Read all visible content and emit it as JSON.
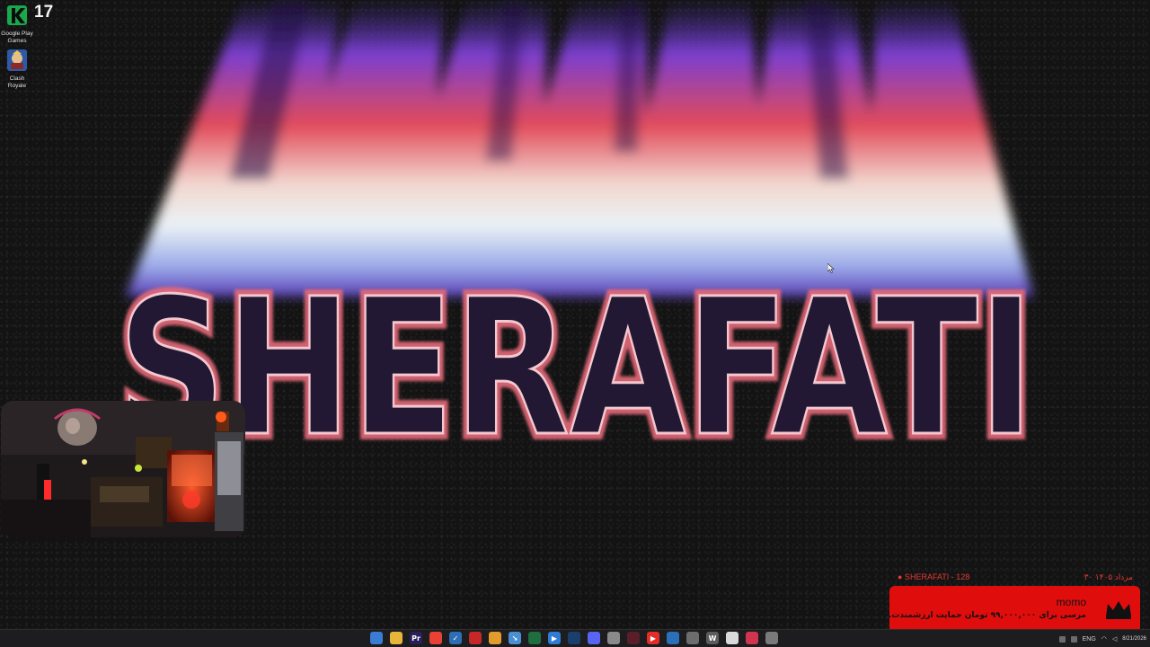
{
  "desktop": {
    "wallpaper_text": "SHERAFATI",
    "fps_counter": "17",
    "icons": [
      {
        "name": "google-play-games",
        "label": "Google Play Games",
        "icon": "google-play-games-icon"
      },
      {
        "name": "clash-royale",
        "label": "Clash Royale",
        "icon": "clash-royale-icon"
      }
    ]
  },
  "donation_alert": {
    "channel": "● SHERAFATI - 128",
    "date": "۳۰ مرداد ۱۴۰۵",
    "donor": "momo",
    "message": "مرسی برای ۹۹,۰۰۰,۰۰۰ تومان حمایت ارزشمندت.",
    "box_color": "#e00d0d"
  },
  "taskbar": {
    "apps": [
      {
        "name": "start-button",
        "glyph": "",
        "color": "#3a7bd5"
      },
      {
        "name": "file-explorer",
        "glyph": "",
        "color": "#e8b43a"
      },
      {
        "name": "premiere-pro",
        "glyph": "Pr",
        "color": "#2a1f5c"
      },
      {
        "name": "chrome",
        "glyph": "",
        "color": "#e94235"
      },
      {
        "name": "app-blue-check",
        "glyph": "✓",
        "color": "#2c6fb5"
      },
      {
        "name": "app-red",
        "glyph": "",
        "color": "#c62828"
      },
      {
        "name": "app-orange",
        "glyph": "",
        "color": "#e39b2c"
      },
      {
        "name": "app-arrow",
        "glyph": "↘",
        "color": "#4a8fd4"
      },
      {
        "name": "app-green-terminal",
        "glyph": "",
        "color": "#1e6e3e"
      },
      {
        "name": "app-play",
        "glyph": "▶",
        "color": "#2f7bd6"
      },
      {
        "name": "steam",
        "glyph": "",
        "color": "#1b3f6d"
      },
      {
        "name": "discord",
        "glyph": "",
        "color": "#5865f2"
      },
      {
        "name": "app-gray-square",
        "glyph": "",
        "color": "#8a8a8a"
      },
      {
        "name": "app-dark-red",
        "glyph": "",
        "color": "#5a1e28"
      },
      {
        "name": "youtube",
        "glyph": "▶",
        "color": "#e52d27"
      },
      {
        "name": "vscode",
        "glyph": "",
        "color": "#2a6fb8"
      },
      {
        "name": "app-circle",
        "glyph": "",
        "color": "#6d6d6d"
      },
      {
        "name": "app-w",
        "glyph": "W",
        "color": "#5c5c5c"
      },
      {
        "name": "notepad",
        "glyph": "",
        "color": "#dadada"
      },
      {
        "name": "app-pink-circle",
        "glyph": "",
        "color": "#d0344e"
      },
      {
        "name": "settings",
        "glyph": "",
        "color": "#7a7a7a"
      }
    ],
    "tray": {
      "lang": "ENG",
      "time": "8/21/2026"
    }
  }
}
